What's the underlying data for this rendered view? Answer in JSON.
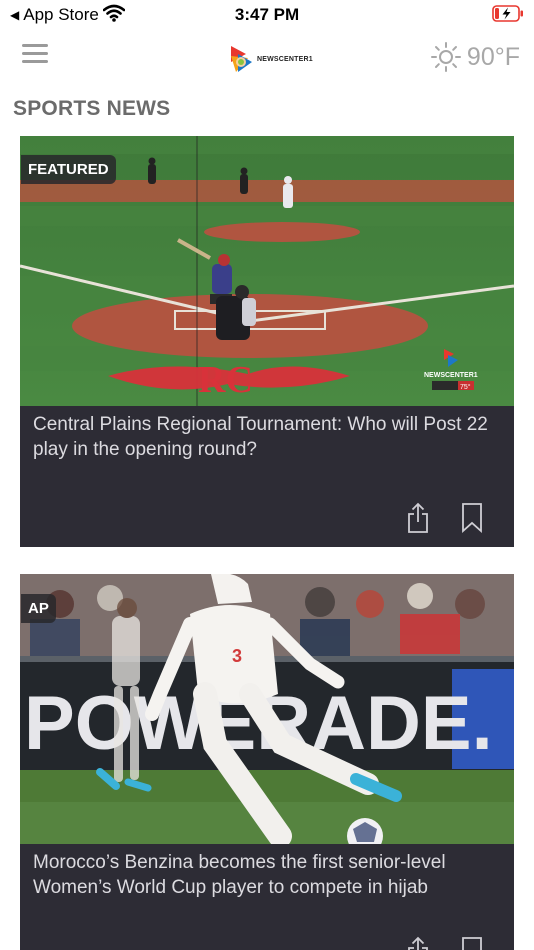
{
  "status_bar": {
    "back_label": "App Store",
    "time": "3:47 PM"
  },
  "header": {
    "menu_icon": "hamburger-menu-icon",
    "logo_text": "NEWSCENTER1",
    "weather_icon": "sun-icon",
    "temperature": "90°F"
  },
  "section_title": "SPORTS NEWS",
  "articles": [
    {
      "badge": "FEATURED",
      "headline": "Central Plains Regional Tournament: Who will Post 22 play in the opening round?",
      "image_logo_text": "NEWSCENTER1",
      "image_temp": "75°"
    },
    {
      "badge": "AP",
      "headline": "Morocco’s Benzina becomes the first senior-level Women’s World Cup player to compete in hijab",
      "image_sign_text": "POWERADE.",
      "image_jersey_number": "3"
    }
  ],
  "colors": {
    "card_bg": "#2d2c35",
    "headline_text": "#dcdbe0",
    "section_title": "#6b6b6b",
    "weather": "#a8a8a8",
    "battery_low": "#e8372e"
  }
}
